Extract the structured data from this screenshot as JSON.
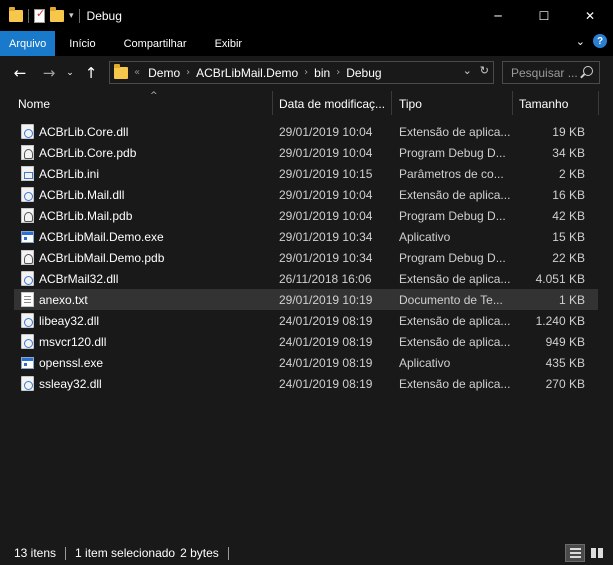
{
  "window": {
    "title": "Debug",
    "minimize": "─",
    "maximize": "☐",
    "close": "✕"
  },
  "ribbon": {
    "tabs": [
      {
        "label": "Arquivo"
      },
      {
        "label": "Início"
      },
      {
        "label": "Compartilhar"
      },
      {
        "label": "Exibir"
      }
    ]
  },
  "nav": {
    "back": "←",
    "forward": "→",
    "recent": "⌄",
    "up": "↑",
    "breadcrumb": [
      "Demo",
      "ACBrLibMail.Demo",
      "bin",
      "Debug"
    ],
    "search_placeholder": "Pesquisar ..."
  },
  "columns": {
    "name": "Nome",
    "date": "Data de modificaç...",
    "type": "Tipo",
    "size": "Tamanho"
  },
  "files": [
    {
      "name": "ACBrLib.Core.dll",
      "date": "29/01/2019 10:04",
      "type": "Extensão de aplica...",
      "size": "19 KB",
      "icon": "dll-icon"
    },
    {
      "name": "ACBrLib.Core.pdb",
      "date": "29/01/2019 10:04",
      "type": "Program Debug D...",
      "size": "34 KB",
      "icon": "pdb-icon"
    },
    {
      "name": "ACBrLib.ini",
      "date": "29/01/2019 10:15",
      "type": "Parâmetros de co...",
      "size": "2 KB",
      "icon": "ini-icon"
    },
    {
      "name": "ACBrLib.Mail.dll",
      "date": "29/01/2019 10:04",
      "type": "Extensão de aplica...",
      "size": "16 KB",
      "icon": "dll-icon"
    },
    {
      "name": "ACBrLib.Mail.pdb",
      "date": "29/01/2019 10:04",
      "type": "Program Debug D...",
      "size": "42 KB",
      "icon": "pdb-icon"
    },
    {
      "name": "ACBrLibMail.Demo.exe",
      "date": "29/01/2019 10:34",
      "type": "Aplicativo",
      "size": "15 KB",
      "icon": "exe-icon"
    },
    {
      "name": "ACBrLibMail.Demo.pdb",
      "date": "29/01/2019 10:34",
      "type": "Program Debug D...",
      "size": "22 KB",
      "icon": "pdb-icon"
    },
    {
      "name": "ACBrMail32.dll",
      "date": "26/11/2018 16:06",
      "type": "Extensão de aplica...",
      "size": "4.051 KB",
      "icon": "dll-icon"
    },
    {
      "name": "anexo.txt",
      "date": "29/01/2019 10:19",
      "type": "Documento de Te...",
      "size": "1 KB",
      "icon": "txt-icon",
      "selected": true
    },
    {
      "name": "libeay32.dll",
      "date": "24/01/2019 08:19",
      "type": "Extensão de aplica...",
      "size": "1.240 KB",
      "icon": "dll-icon"
    },
    {
      "name": "msvcr120.dll",
      "date": "24/01/2019 08:19",
      "type": "Extensão de aplica...",
      "size": "949 KB",
      "icon": "dll-icon"
    },
    {
      "name": "openssl.exe",
      "date": "24/01/2019 08:19",
      "type": "Aplicativo",
      "size": "435 KB",
      "icon": "exe-icon"
    },
    {
      "name": "ssleay32.dll",
      "date": "24/01/2019 08:19",
      "type": "Extensão de aplica...",
      "size": "270 KB",
      "icon": "dll-icon"
    }
  ],
  "status": {
    "item_count": "13 itens",
    "selection": "1 item selecionado",
    "selection_size": "2 bytes"
  },
  "colors": {
    "accent": "#1979ca",
    "background": "#191919",
    "selected_row": "#333333"
  }
}
